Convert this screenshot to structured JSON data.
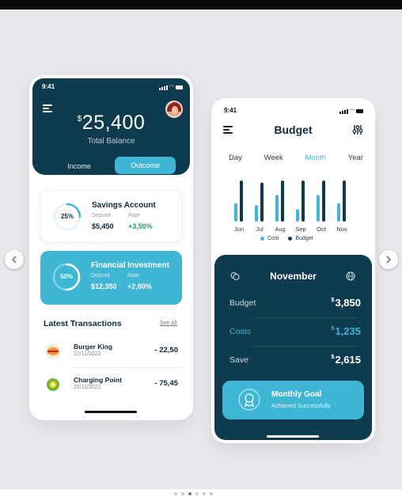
{
  "phone1": {
    "status_time": "9:41",
    "balance": {
      "currency": "$",
      "amount": "25,400",
      "label": "Total Balance"
    },
    "tabs": {
      "income": "Income",
      "outcome": "Outcome"
    },
    "savings": {
      "percent": "25%",
      "progress": 0.25,
      "title": "Savings Account",
      "deposit_label": "Deposit",
      "deposit_value": "$5,450",
      "rate_label": "Rate",
      "rate_value": "+3,50%"
    },
    "investment": {
      "percent": "50%",
      "progress": 0.5,
      "title": "Financial Investment",
      "deposit_label": "Deposit",
      "deposit_value": "$12,350",
      "rate_label": "Rate",
      "rate_value": "+2,80%"
    },
    "transactions_title": "Latest Transactions",
    "see_all": "See All",
    "transactions": [
      {
        "name": "Burger King",
        "date": "22/11/2022",
        "amount": "- 22,50",
        "icon": "burger-king-logo"
      },
      {
        "name": "Charging Point",
        "date": "22/11/2022",
        "amount": "- 75,45",
        "icon": "bp-logo"
      }
    ]
  },
  "phone2": {
    "status_time": "9:41",
    "title": "Budget",
    "periods": [
      "Day",
      "Week",
      "Month",
      "Year"
    ],
    "active_period": "Month",
    "legend": {
      "cost": "Cost",
      "budget": "Budget"
    },
    "month": "November",
    "rows": [
      {
        "label": "Budget",
        "currency": "$",
        "value": "3,850",
        "highlight": false
      },
      {
        "label": "Costs",
        "currency": "$",
        "value": "1,235",
        "highlight": true
      },
      {
        "label": "Save",
        "currency": "$",
        "value": "2,615",
        "highlight": false
      }
    ],
    "goal": {
      "title": "Monthly Goal",
      "subtitle": "Achieved Successfully"
    }
  },
  "colors": {
    "navy": "#0f3b4e",
    "accent": "#3fb6d4",
    "positive": "#1aa56e",
    "background": "#e6e8ec"
  },
  "chart_data": {
    "type": "bar",
    "categories": [
      "Jun",
      "Jul",
      "Aug",
      "Sep",
      "Oct",
      "Nov"
    ],
    "series": [
      {
        "name": "Cost",
        "values": [
          45,
          40,
          65,
          30,
          65,
          45
        ]
      },
      {
        "name": "Budget",
        "values": [
          100,
          95,
          100,
          100,
          100,
          100
        ]
      }
    ],
    "ylim": [
      0,
      100
    ],
    "legend": "bottom",
    "colors": {
      "Cost": "#3fb6d4",
      "Budget": "#0f3b4e"
    }
  }
}
